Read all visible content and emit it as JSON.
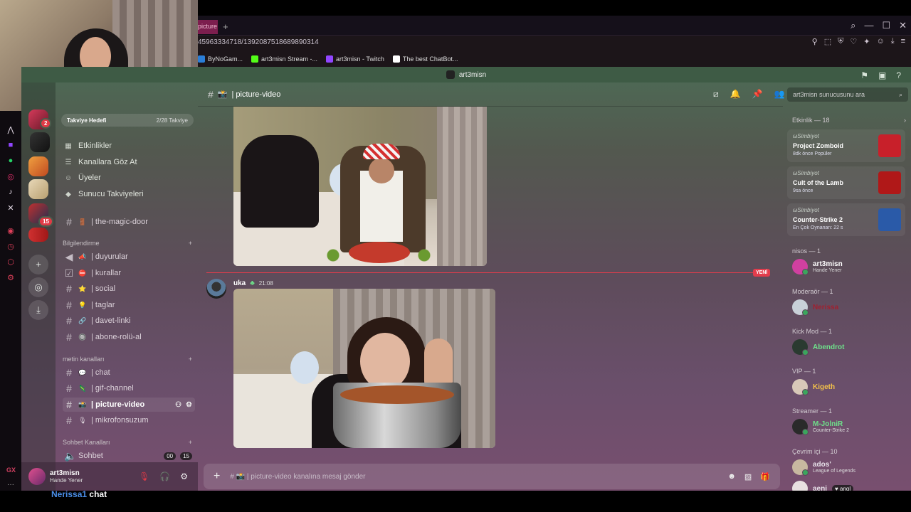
{
  "browser": {
    "tab_label": "picture",
    "url": "45963334718/1392087518689890314",
    "bookmarks": [
      {
        "label": "ByNoGam...",
        "color": "#2a7ed8"
      },
      {
        "label": "art3misn Stream -...",
        "color": "#53fc18"
      },
      {
        "label": "art3misn - Twitch",
        "color": "#9146ff"
      },
      {
        "label": "The best ChatBot...",
        "color": "#ffffff"
      }
    ]
  },
  "window": {
    "title": "art3misn"
  },
  "servers": {
    "badges": [
      "2",
      "15"
    ]
  },
  "boost": {
    "label": "Takviye Hedefi",
    "progress": "2/28 Takviye"
  },
  "nav": {
    "events": "Etkinlikler",
    "browse": "Kanallara Göz At",
    "members": "Üyeler",
    "boosts": "Sunucu Takviyeleri"
  },
  "channels": {
    "magic_door": "| the-magic-door",
    "cat_info": "Bilgilendirme",
    "info": [
      "| duyurular",
      "| kurallar",
      "| social",
      "| taglar",
      "| davet-linki",
      "| abone-rolü-al"
    ],
    "cat_text": "metin kanalları",
    "text": [
      "| chat",
      "| gif-channel",
      "| picture-video",
      "| mikrofonsuzum"
    ],
    "cat_voice": "Sohbet Kanalları",
    "voice": "Sohbet",
    "voice_counts": [
      "00",
      "15"
    ]
  },
  "user": {
    "name": "art3misn",
    "status": "Hande Yener"
  },
  "overlay_chat": {
    "user": "Nerissa1",
    "channel": "chat"
  },
  "channel_header": {
    "name": "| picture-video",
    "search_placeholder": "art3misn sunucusunu ara"
  },
  "messages": {
    "new_tag": "YENİ",
    "author": "uka",
    "time": "21:08"
  },
  "composer": {
    "placeholder": "| picture-video kanalına mesaj gönder"
  },
  "sidebar": {
    "events_header": "Etkinlik — 18",
    "activities": [
      {
        "user": "ωSimbiyot",
        "game": "Project Zomboid",
        "sub": "8dk önce  Popüler",
        "color": "#c8202a"
      },
      {
        "user": "ωSimbiyot",
        "game": "Cult of the Lamb",
        "sub": "9sa önce",
        "color": "#b01818"
      },
      {
        "user": "ωSimbiyot",
        "game": "Counter-Strike 2",
        "sub": "En Çok Oynanan: 22 s",
        "color": "#2a5aa8"
      }
    ],
    "groups": [
      {
        "title": "nisos — 1",
        "name": "art3misn",
        "sub": "Hande Yener",
        "color": "#ffffff"
      },
      {
        "title": "Moderaör — 1",
        "name": "Nerissa",
        "sub": "",
        "color": "#a02030"
      },
      {
        "title": "Kick Mod — 1",
        "name": "Abendrot",
        "sub": "",
        "color": "#6ee08a"
      },
      {
        "title": "VIP — 1",
        "name": "Kigeth",
        "sub": "",
        "color": "#f2c14a"
      },
      {
        "title": "Streamer — 1",
        "name": "M-JolniR",
        "sub": "Counter-Strike 2",
        "color": "#6ee08a"
      },
      {
        "title": "Çevrim içi — 10",
        "name": "ados'",
        "sub": "League of Legends",
        "color": "#e8e2ea"
      }
    ],
    "last_member": {
      "name": "aeni",
      "tag": "angl"
    }
  }
}
